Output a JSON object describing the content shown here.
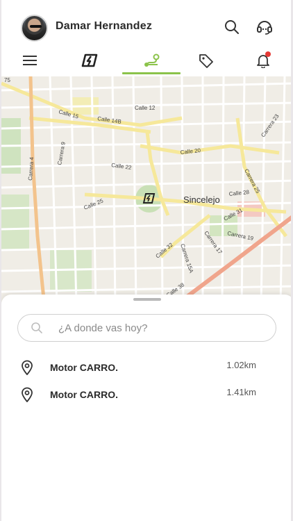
{
  "header": {
    "user_name": "Damar Hernandez"
  },
  "nav": {
    "items": [
      {
        "name": "menu",
        "icon": "hamburger-menu-icon"
      },
      {
        "name": "taxi",
        "icon": "vehicle-logo-icon"
      },
      {
        "name": "route",
        "icon": "route-icon",
        "active": true
      },
      {
        "name": "promos",
        "icon": "tag-icon"
      },
      {
        "name": "notifications",
        "icon": "bell-icon",
        "badge": true
      }
    ],
    "accent_color": "#8bc34a",
    "badge_color": "#e53935"
  },
  "map": {
    "city_label": "Sincelejo",
    "streets": [
      "Calle 15",
      "Calle 14B",
      "Calle 12",
      "Calle 20",
      "Calle 22",
      "Calle 25",
      "Calle 28",
      "Calle 31",
      "Calle 32",
      "Calle 38",
      "Carrera 4",
      "Carrera 9",
      "Carrera 17",
      "Carrera 19",
      "Carrera 23",
      "Carrera 25",
      "Carrera 15A",
      "75"
    ]
  },
  "sheet": {
    "search_placeholder": "¿A donde vas hoy?",
    "places": [
      {
        "name": "Motor CARRO.",
        "distance": "1.02km"
      },
      {
        "name": "Motor CARRO.",
        "distance": "1.41km"
      }
    ]
  }
}
